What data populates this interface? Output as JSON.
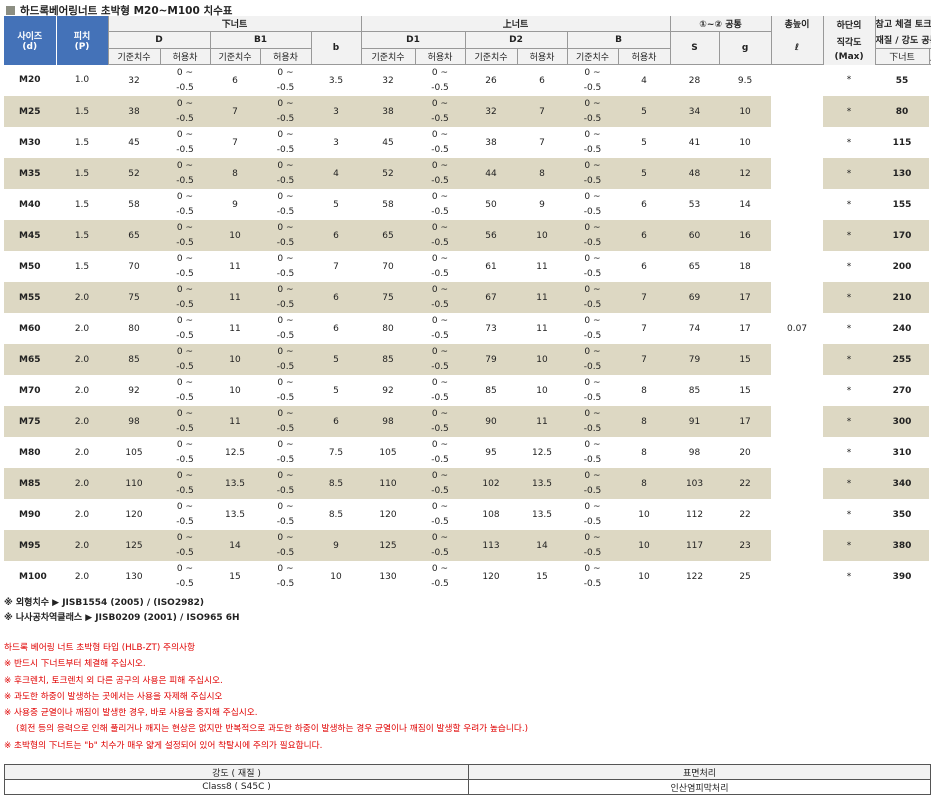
{
  "title": "하드록베어링너트 초박형 M20~M100 치수표",
  "header": {
    "size": "사이즈",
    "size_sub": "(d)",
    "pitch": "피치",
    "pitch_sub": "(P)",
    "lower_nut": "下너트",
    "upper_nut": "上너트",
    "common_12": "①~② 공통",
    "total_height": "총높이",
    "perp_1": "하단의",
    "perp_2": "직각도",
    "perp_3": "(Max)",
    "torque_1": "참고 체결 토크",
    "torque_2": "재질 / 강도 공통",
    "D": "D",
    "B1": "B1",
    "b": "b",
    "D1": "D1",
    "D2": "D2",
    "B": "B",
    "S": "S",
    "g": "g",
    "ell": "ℓ",
    "std": "기준치수",
    "tol": "허용차",
    "lower": "下너트",
    "upper": "上너트"
  },
  "tol_top": "0 ~",
  "tol_bot": "-0.5",
  "perpendicularity": "0.07",
  "rows": [
    {
      "size": "M20",
      "pitch": "1.0",
      "D": "32",
      "B1": "6",
      "b": "3.5",
      "D1": "32",
      "D2": "26",
      "B": "6",
      "S": "4",
      "g": "28",
      "l": "9.5",
      "lower": "*",
      "upper": "55"
    },
    {
      "size": "M25",
      "pitch": "1.5",
      "D": "38",
      "B1": "7",
      "b": "3",
      "D1": "38",
      "D2": "32",
      "B": "7",
      "S": "5",
      "g": "34",
      "l": "10",
      "lower": "*",
      "upper": "80"
    },
    {
      "size": "M30",
      "pitch": "1.5",
      "D": "45",
      "B1": "7",
      "b": "3",
      "D1": "45",
      "D2": "38",
      "B": "7",
      "S": "5",
      "g": "41",
      "l": "10",
      "lower": "*",
      "upper": "115"
    },
    {
      "size": "M35",
      "pitch": "1.5",
      "D": "52",
      "B1": "8",
      "b": "4",
      "D1": "52",
      "D2": "44",
      "B": "8",
      "S": "5",
      "g": "48",
      "l": "12",
      "lower": "*",
      "upper": "130"
    },
    {
      "size": "M40",
      "pitch": "1.5",
      "D": "58",
      "B1": "9",
      "b": "5",
      "D1": "58",
      "D2": "50",
      "B": "9",
      "S": "6",
      "g": "53",
      "l": "14",
      "lower": "*",
      "upper": "155"
    },
    {
      "size": "M45",
      "pitch": "1.5",
      "D": "65",
      "B1": "10",
      "b": "6",
      "D1": "65",
      "D2": "56",
      "B": "10",
      "S": "6",
      "g": "60",
      "l": "16",
      "lower": "*",
      "upper": "170"
    },
    {
      "size": "M50",
      "pitch": "1.5",
      "D": "70",
      "B1": "11",
      "b": "7",
      "D1": "70",
      "D2": "61",
      "B": "11",
      "S": "6",
      "g": "65",
      "l": "18",
      "lower": "*",
      "upper": "200"
    },
    {
      "size": "M55",
      "pitch": "2.0",
      "D": "75",
      "B1": "11",
      "b": "6",
      "D1": "75",
      "D2": "67",
      "B": "11",
      "S": "7",
      "g": "69",
      "l": "17",
      "lower": "*",
      "upper": "210"
    },
    {
      "size": "M60",
      "pitch": "2.0",
      "D": "80",
      "B1": "11",
      "b": "6",
      "D1": "80",
      "D2": "73",
      "B": "11",
      "S": "7",
      "g": "74",
      "l": "17",
      "lower": "*",
      "upper": "240"
    },
    {
      "size": "M65",
      "pitch": "2.0",
      "D": "85",
      "B1": "10",
      "b": "5",
      "D1": "85",
      "D2": "79",
      "B": "10",
      "S": "7",
      "g": "79",
      "l": "15",
      "lower": "*",
      "upper": "255"
    },
    {
      "size": "M70",
      "pitch": "2.0",
      "D": "92",
      "B1": "10",
      "b": "5",
      "D1": "92",
      "D2": "85",
      "B": "10",
      "S": "8",
      "g": "85",
      "l": "15",
      "lower": "*",
      "upper": "270"
    },
    {
      "size": "M75",
      "pitch": "2.0",
      "D": "98",
      "B1": "11",
      "b": "6",
      "D1": "98",
      "D2": "90",
      "B": "11",
      "S": "8",
      "g": "91",
      "l": "17",
      "lower": "*",
      "upper": "300"
    },
    {
      "size": "M80",
      "pitch": "2.0",
      "D": "105",
      "B1": "12.5",
      "b": "7.5",
      "D1": "105",
      "D2": "95",
      "B": "12.5",
      "S": "8",
      "g": "98",
      "l": "20",
      "lower": "*",
      "upper": "310"
    },
    {
      "size": "M85",
      "pitch": "2.0",
      "D": "110",
      "B1": "13.5",
      "b": "8.5",
      "D1": "110",
      "D2": "102",
      "B": "13.5",
      "S": "8",
      "g": "103",
      "l": "22",
      "lower": "*",
      "upper": "340"
    },
    {
      "size": "M90",
      "pitch": "2.0",
      "D": "120",
      "B1": "13.5",
      "b": "8.5",
      "D1": "120",
      "D2": "108",
      "B": "13.5",
      "S": "10",
      "g": "112",
      "l": "22",
      "lower": "*",
      "upper": "350"
    },
    {
      "size": "M95",
      "pitch": "2.0",
      "D": "125",
      "B1": "14",
      "b": "9",
      "D1": "125",
      "D2": "113",
      "B": "14",
      "S": "10",
      "g": "117",
      "l": "23",
      "lower": "*",
      "upper": "380"
    },
    {
      "size": "M100",
      "pitch": "2.0",
      "D": "130",
      "B1": "15",
      "b": "10",
      "D1": "130",
      "D2": "120",
      "B": "15",
      "S": "10",
      "g": "122",
      "l": "25",
      "lower": "*",
      "upper": "390"
    }
  ],
  "notes": [
    "※ 외형치수 ▶ JISB1554 (2005) / (ISO2982)",
    "※ 나사공차역클래스 ▶ JISB0209 (2001) / ISO965 6H"
  ],
  "cautions": [
    "하드록 베어링 너트 초박형 타입 (HLB-ZT) 주의사항",
    "※ 반드시 下너트부터 체결해 주십시오.",
    "※ 후크렌치, 토크렌치 외 다른 공구의 사용은 피해 주십시오.",
    "※ 과도한 하중이 발생하는 곳에서는 사용을 자제해 주십시오",
    "※ 사용중 균열이나 깨짐이 발생한 경우, 바로 사용을 중지해 주십시오.",
    "(회전 등의 응력으로 인해 풀리거나 깨지는 현상은 없지만 반복적으로 과도한 하중이 발생하는 경우 균열이나 깨짐이 발생할 우려가 높습니다.)",
    "※ 초박형의 下너트는 \"b\" 치수가 매우 얇게 설정되어 있어 착탈시에 주의가 필요합니다."
  ],
  "bottom": {
    "strength_header": "강도 ( 재질 )",
    "surface_header": "표면처리",
    "strength_value": "Class8 ( S45C )",
    "surface_value": "인산염피막처리"
  }
}
